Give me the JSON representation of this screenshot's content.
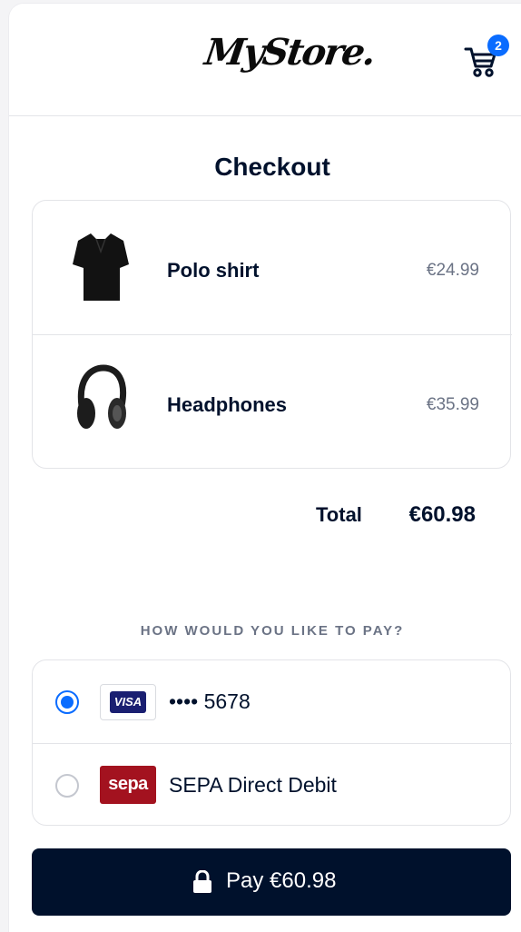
{
  "header": {
    "logo_text": "MyStore.",
    "cart_count": "2",
    "cart_icon": "cart-icon"
  },
  "page_title": "Checkout",
  "items": [
    {
      "name": "Polo shirt",
      "price": "€24.99",
      "icon": "polo-shirt-image"
    },
    {
      "name": "Headphones",
      "price": "€35.99",
      "icon": "headphones-image"
    }
  ],
  "total": {
    "label": "Total",
    "value": "€60.98"
  },
  "payment": {
    "heading": "HOW WOULD YOU LIKE TO PAY?",
    "methods": [
      {
        "brand": "VISA",
        "label": "•••• 5678",
        "selected": true
      },
      {
        "brand": "sepa",
        "label": "SEPA Direct Debit",
        "selected": false
      }
    ]
  },
  "pay_button": {
    "label": "Pay €60.98",
    "icon": "lock-icon"
  },
  "colors": {
    "primary": "#00112c",
    "accent": "#0a6cff",
    "muted": "#6b7385",
    "sepa": "#a3121f",
    "visa": "#1a1f71"
  }
}
